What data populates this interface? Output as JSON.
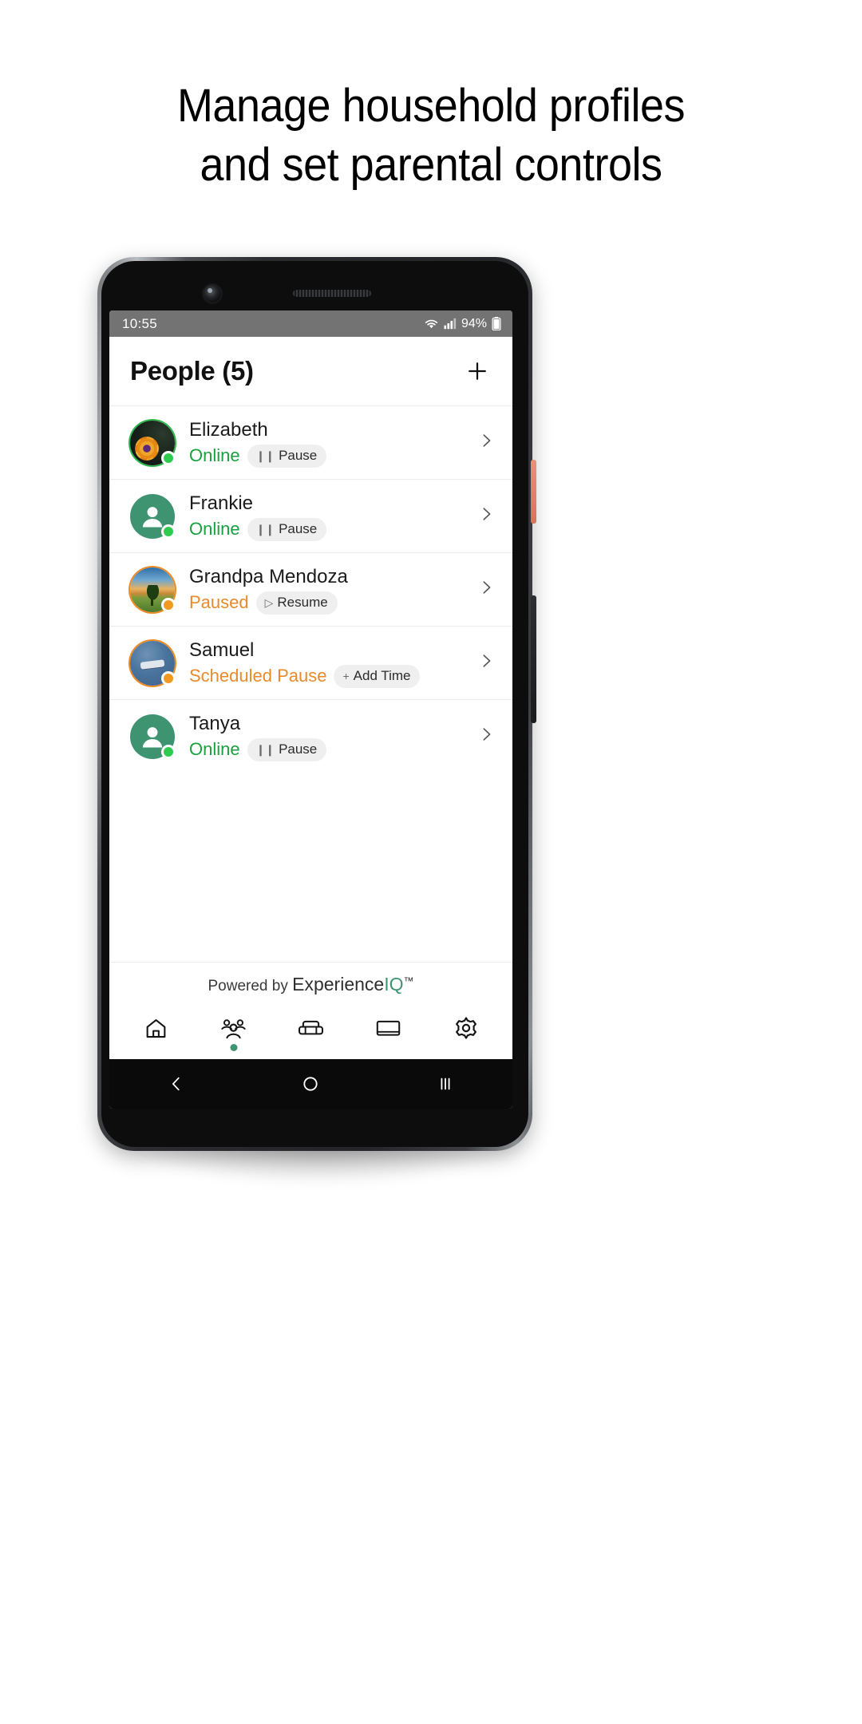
{
  "headline": {
    "line1": "Manage household profiles",
    "line2": "and set parental controls"
  },
  "colors": {
    "online_green": "#19a03f",
    "paused_orange": "#e88a2a",
    "brand_green": "#3e9470",
    "statusbar_gray": "#737373",
    "dot_green": "#2ecb4f",
    "dot_orange": "#f2991f"
  },
  "phone": {
    "statusbar": {
      "time": "10:55",
      "battery_percent": "94%",
      "icons": [
        "wifi-icon",
        "cellular-signal-icon",
        "battery-icon"
      ]
    },
    "app": {
      "header": {
        "title": "People (5)",
        "add_label": "+"
      },
      "people": [
        {
          "name": "Elizabeth",
          "status": "Online",
          "status_type": "online",
          "action_label": "Pause",
          "action_icon": "pause-icon",
          "avatar_type": "photo-flower",
          "dot": "green"
        },
        {
          "name": "Frankie",
          "status": "Online",
          "status_type": "online",
          "action_label": "Pause",
          "action_icon": "pause-icon",
          "avatar_type": "person-green",
          "dot": "green"
        },
        {
          "name": "Grandpa Mendoza",
          "status": "Paused",
          "status_type": "paused",
          "action_label": "Resume",
          "action_icon": "play-icon",
          "avatar_type": "photo-landscape",
          "dot": "orange"
        },
        {
          "name": "Samuel",
          "status": "Scheduled Pause",
          "status_type": "paused",
          "action_label": "Add Time",
          "action_icon": "plus-icon",
          "avatar_type": "photo-blue",
          "dot": "orange"
        },
        {
          "name": "Tanya",
          "status": "Online",
          "status_type": "online",
          "action_label": "Pause",
          "action_icon": "pause-icon",
          "avatar_type": "person-green",
          "dot": "green"
        }
      ],
      "footer": {
        "powered_prefix": "Powered by ",
        "brand_part1": "Experience",
        "brand_part2": "IQ",
        "brand_tm": "™"
      },
      "tabs": [
        {
          "name": "home",
          "icon": "home-icon",
          "active": false
        },
        {
          "name": "people",
          "icon": "people-group-icon",
          "active": true
        },
        {
          "name": "places",
          "icon": "sofa-icon",
          "active": false
        },
        {
          "name": "devices",
          "icon": "monitor-icon",
          "active": false
        },
        {
          "name": "settings",
          "icon": "gear-icon",
          "active": false
        }
      ]
    },
    "android_nav": {
      "back": "back-icon",
      "home": "home-circle-icon",
      "recents": "recents-icon"
    }
  }
}
